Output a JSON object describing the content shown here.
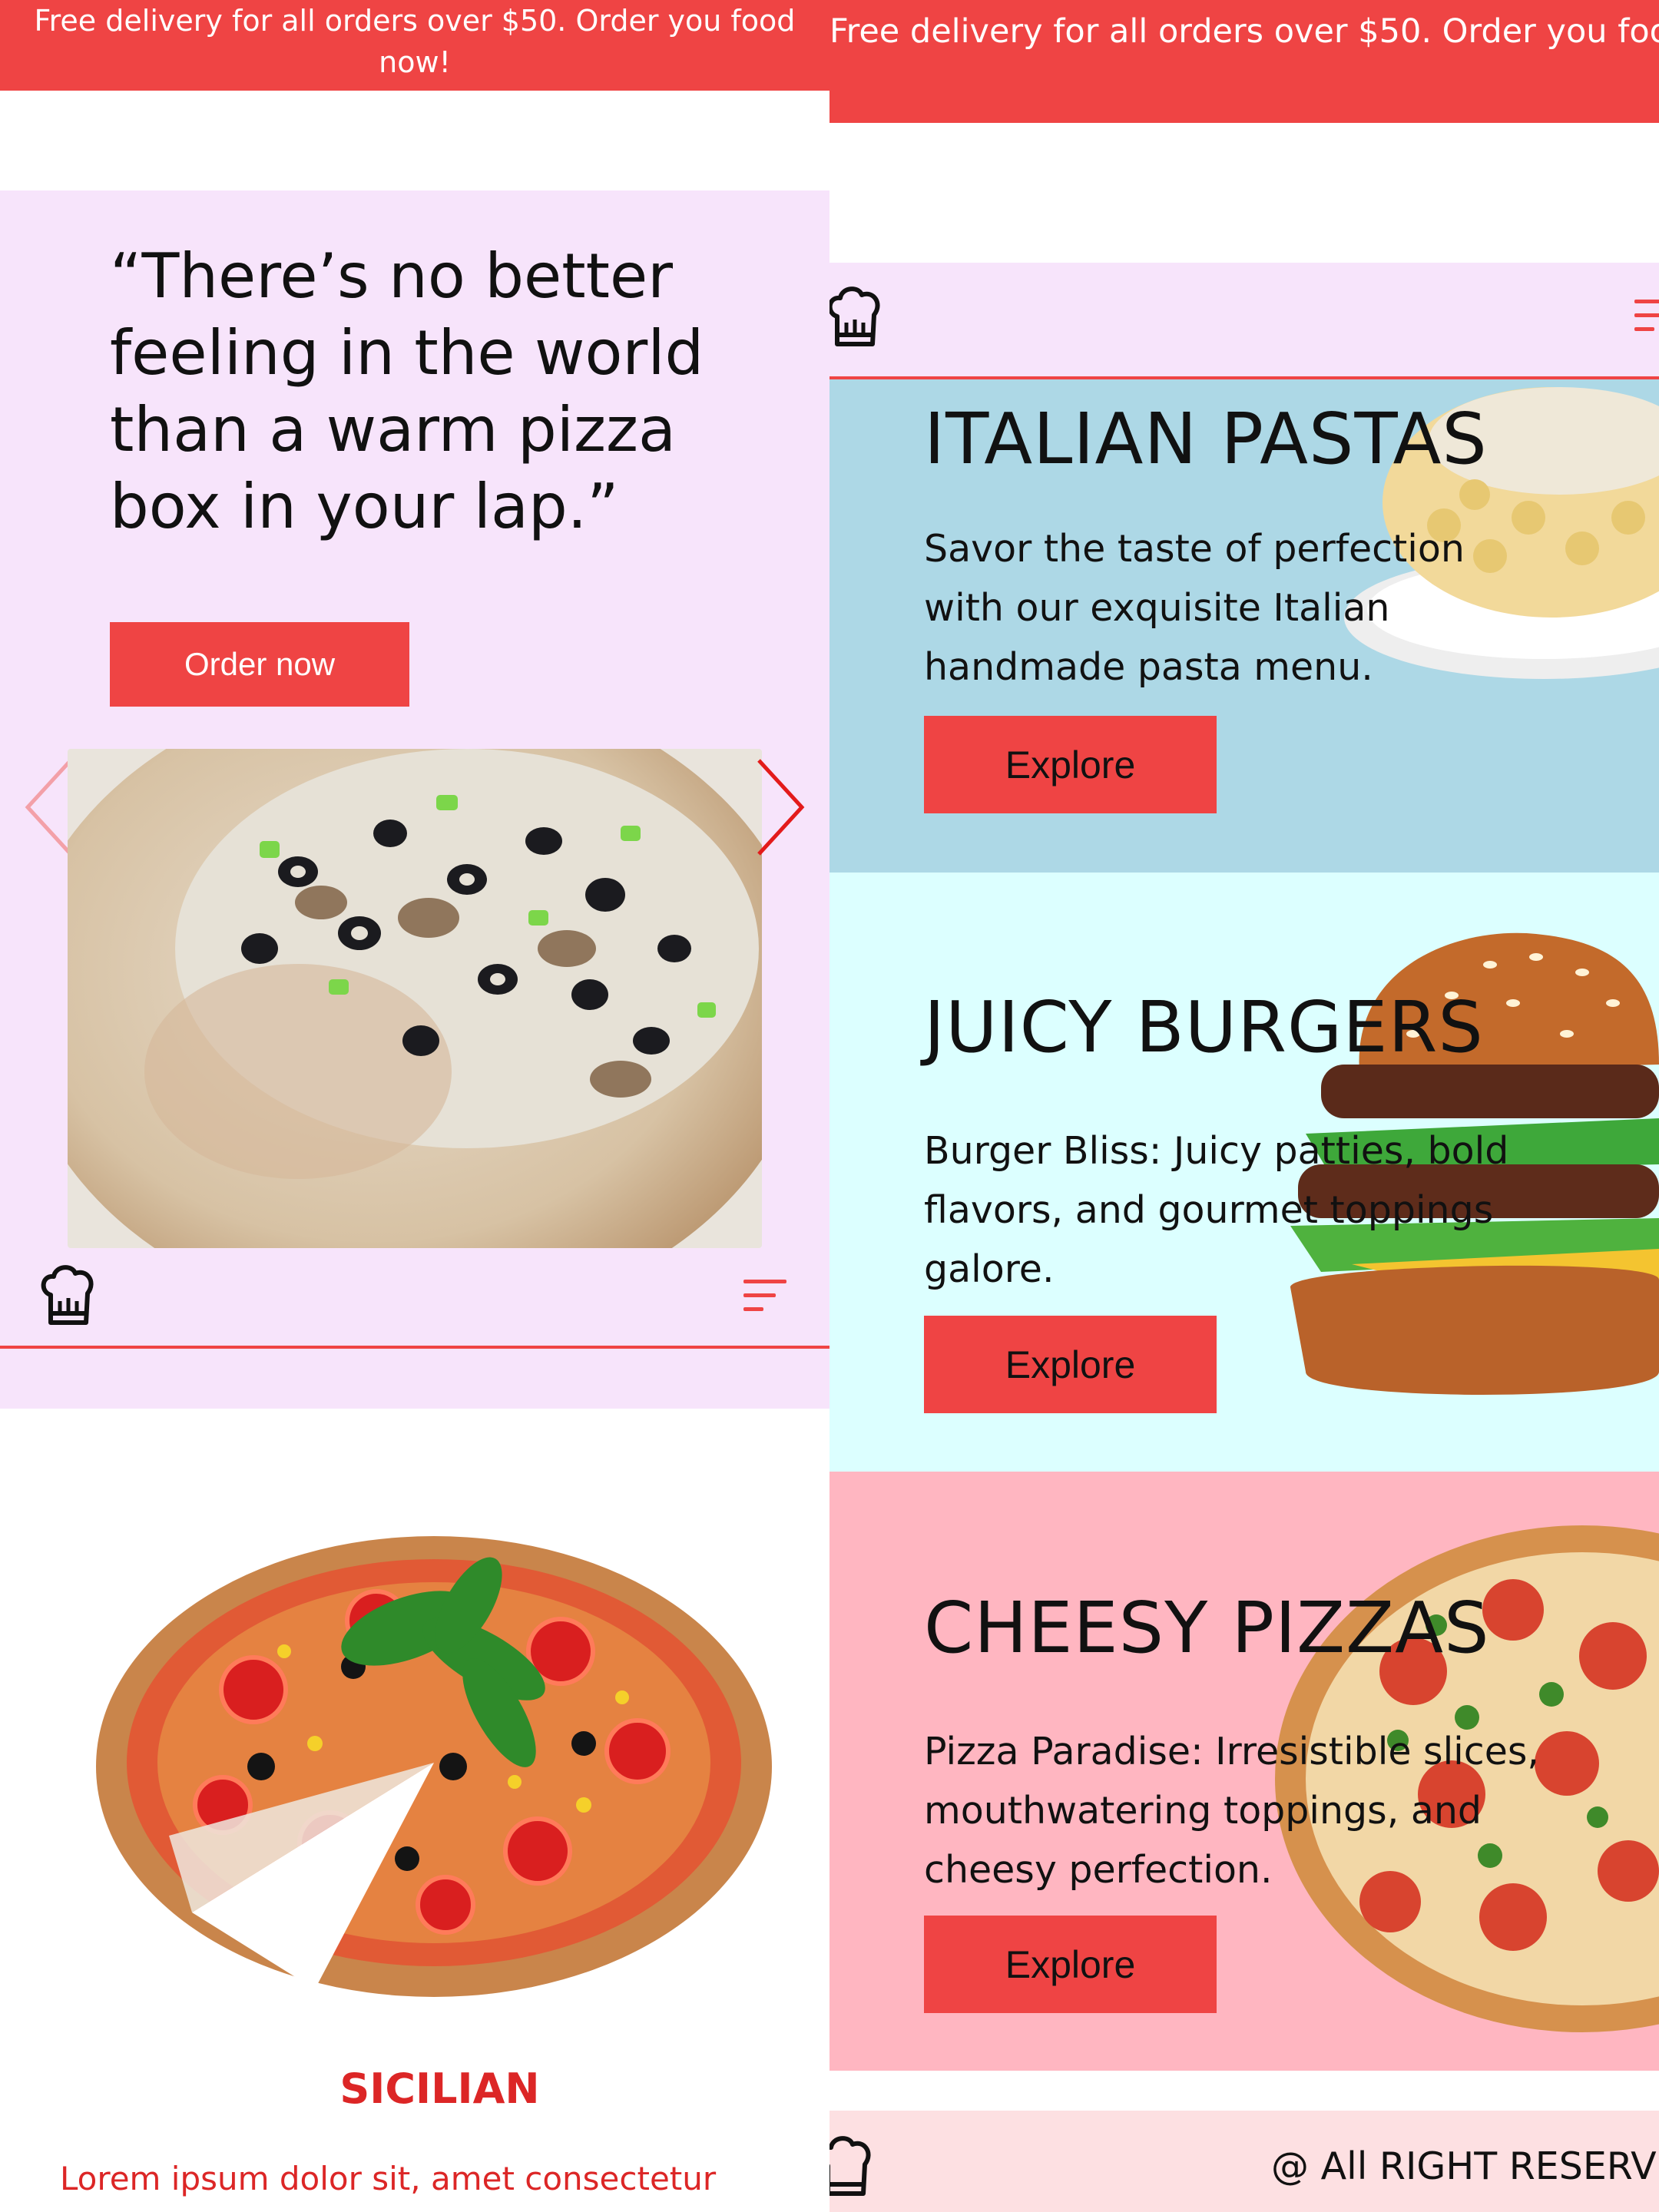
{
  "banner": {
    "text": "Free delivery for all orders over $50. Order you food now!"
  },
  "hero": {
    "quote": "“There’s no better feeling in the world than a warm pizza box in your lap.”",
    "order_label": "Order now"
  },
  "product": {
    "name": "SICILIAN",
    "description": "Lorem ipsum dolor sit, amet consectetur"
  },
  "sections": [
    {
      "title": "ITALIAN PASTAS",
      "desc": "Savor the taste of perfection with our exquisite Italian handmade pasta menu.",
      "button": "Explore"
    },
    {
      "title": "JUICY BURGERS",
      "desc": "Burger Bliss: Juicy patties, bold flavors, and gourmet toppings galore.",
      "button": "Explore"
    },
    {
      "title": "CHEESY PIZZAS",
      "desc": "Pizza Paradise: Irresistible slices, mouthwatering toppings, and cheesy perfection.",
      "button": "Explore"
    }
  ],
  "footer": {
    "copyright": "@ All RIGHT RESERVED"
  },
  "icons": {
    "logo": "chef-hat-icon",
    "menu": "menu-icon",
    "prev": "chevron-left-icon",
    "next": "chevron-right-icon"
  },
  "colors": {
    "accent": "#ef4444",
    "hero_bg": "#f7e4fb",
    "pasta_bg": "#add8e6",
    "burger_bg": "#dcffff",
    "pizza_bg": "#ffb6c1",
    "footer_bg": "#fde0e2",
    "product_text": "#dc2626"
  }
}
